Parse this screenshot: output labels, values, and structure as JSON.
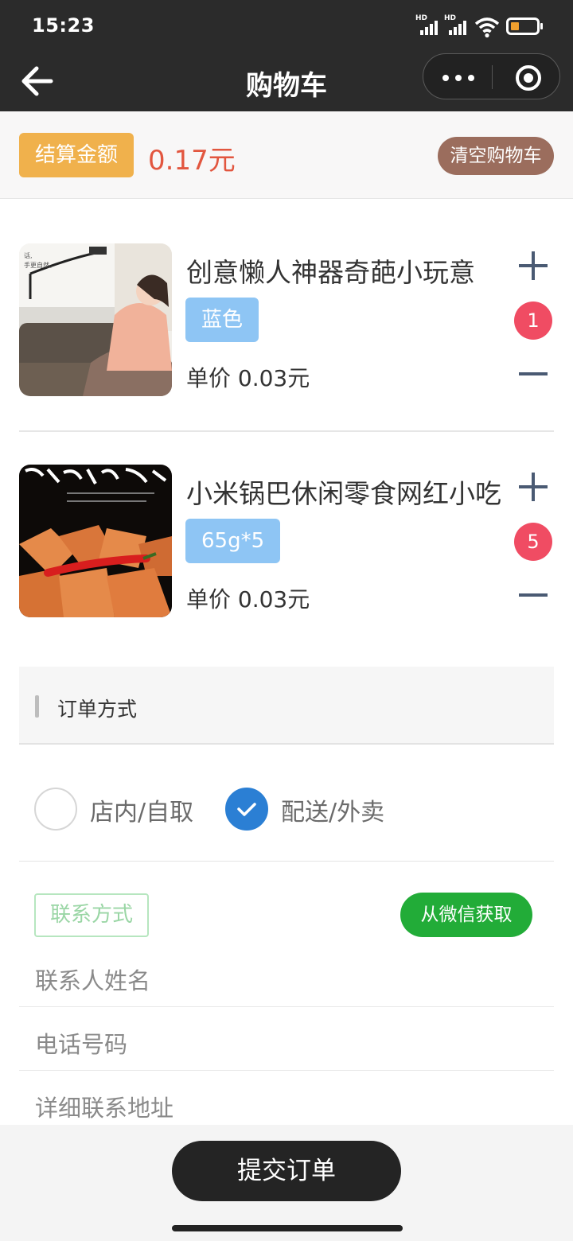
{
  "status_bar": {
    "time": "15:23",
    "signal_labels": [
      "HD",
      "HD"
    ],
    "battery_color": "#f0a02e"
  },
  "nav": {
    "title": "购物车",
    "back_icon": "arrow-left-icon",
    "more_icon": "more-dots-icon",
    "close_icon": "target-circle-icon"
  },
  "summary": {
    "total_label": "结算金额",
    "total_amount": "0.17元",
    "clear_label": "清空购物车"
  },
  "cart_items": [
    {
      "name": "创意懒人神器奇葩小玩意",
      "spec": "蓝色",
      "price": "单价 0.03元",
      "quantity": "1"
    },
    {
      "name": "小米锅巴休闲零食网红小吃",
      "spec": "65g*5",
      "price": "单价 0.03元",
      "quantity": "5"
    }
  ],
  "order_method": {
    "title": "订单方式",
    "options": [
      {
        "label": "店内/自取",
        "selected": false
      },
      {
        "label": "配送/外卖",
        "selected": true
      }
    ]
  },
  "contact": {
    "tag": "联系方式",
    "wechat_button": "从微信获取",
    "fields": [
      {
        "placeholder": "联系人姓名"
      },
      {
        "placeholder": "电话号码"
      },
      {
        "placeholder": "详细联系地址"
      }
    ]
  },
  "footer": {
    "submit_label": "提交订单"
  },
  "colors": {
    "accent_orange": "#f0b14c",
    "price_red": "#e2563f",
    "badge_red": "#f04c63",
    "spec_blue": "#8ec5f4",
    "radio_blue": "#2b7fd4",
    "wechat_green": "#22ac38"
  }
}
